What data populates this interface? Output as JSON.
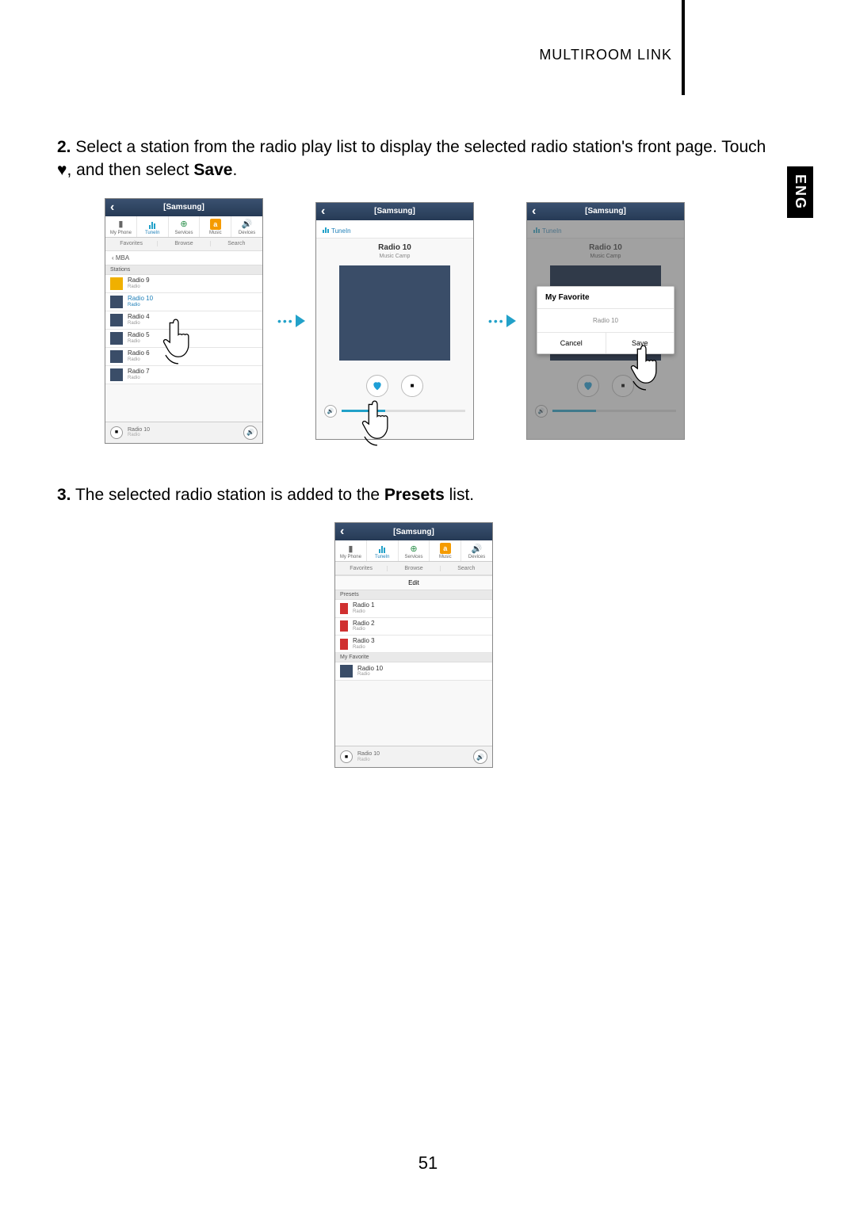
{
  "header": {
    "section": "MULTIROOM LINK",
    "lang": "ENG"
  },
  "page_number": "51",
  "step2": {
    "num": "2.",
    "text_a": "Select a station from the radio play list to display the selected radio station's front page. Touch ",
    "text_b": ", and then select ",
    "save": "Save",
    "period": "."
  },
  "step3": {
    "num": "3.",
    "text_a": "The selected radio station is added to the ",
    "presets": "Presets",
    "text_b": " list."
  },
  "common": {
    "header_title": "[Samsung]",
    "src": {
      "myphone": "My Phone",
      "tunein": "TuneIn",
      "services": "Services",
      "music": "Music",
      "devices": "Devices"
    },
    "tabs": {
      "favorites": "Favorites",
      "browse": "Browse",
      "search": "Search"
    },
    "footer": {
      "now": "Radio 10",
      "sub": "Radio"
    }
  },
  "s1": {
    "crumb": "MBA",
    "section": "Stations",
    "items": [
      {
        "name": "Radio 9",
        "sub": "Radio"
      },
      {
        "name": "Radio 10",
        "sub": "Radio",
        "hl": true
      },
      {
        "name": "Radio 4",
        "sub": "Radio"
      },
      {
        "name": "Radio 5",
        "sub": "Radio"
      },
      {
        "name": "Radio 6",
        "sub": "Radio"
      },
      {
        "name": "Radio 7",
        "sub": "Radio"
      }
    ]
  },
  "s2": {
    "service": "TuneIn",
    "now": "Radio 10",
    "sub": "Music Camp"
  },
  "s3": {
    "service": "TuneIn",
    "now": "Radio 10",
    "sub": "Music Camp",
    "dialog": {
      "title": "My Favorite",
      "row": "Radio 10",
      "cancel": "Cancel",
      "save": "Save"
    }
  },
  "s4": {
    "edit": "Edit",
    "presets_label": "Presets",
    "myfav_label": "My Favorite",
    "presets": [
      {
        "name": "Radio 1",
        "sub": "Radio"
      },
      {
        "name": "Radio 2",
        "sub": "Radio"
      },
      {
        "name": "Radio 3",
        "sub": "Radio"
      }
    ],
    "myfav": [
      {
        "name": "Radio 10",
        "sub": "Radio"
      }
    ]
  }
}
